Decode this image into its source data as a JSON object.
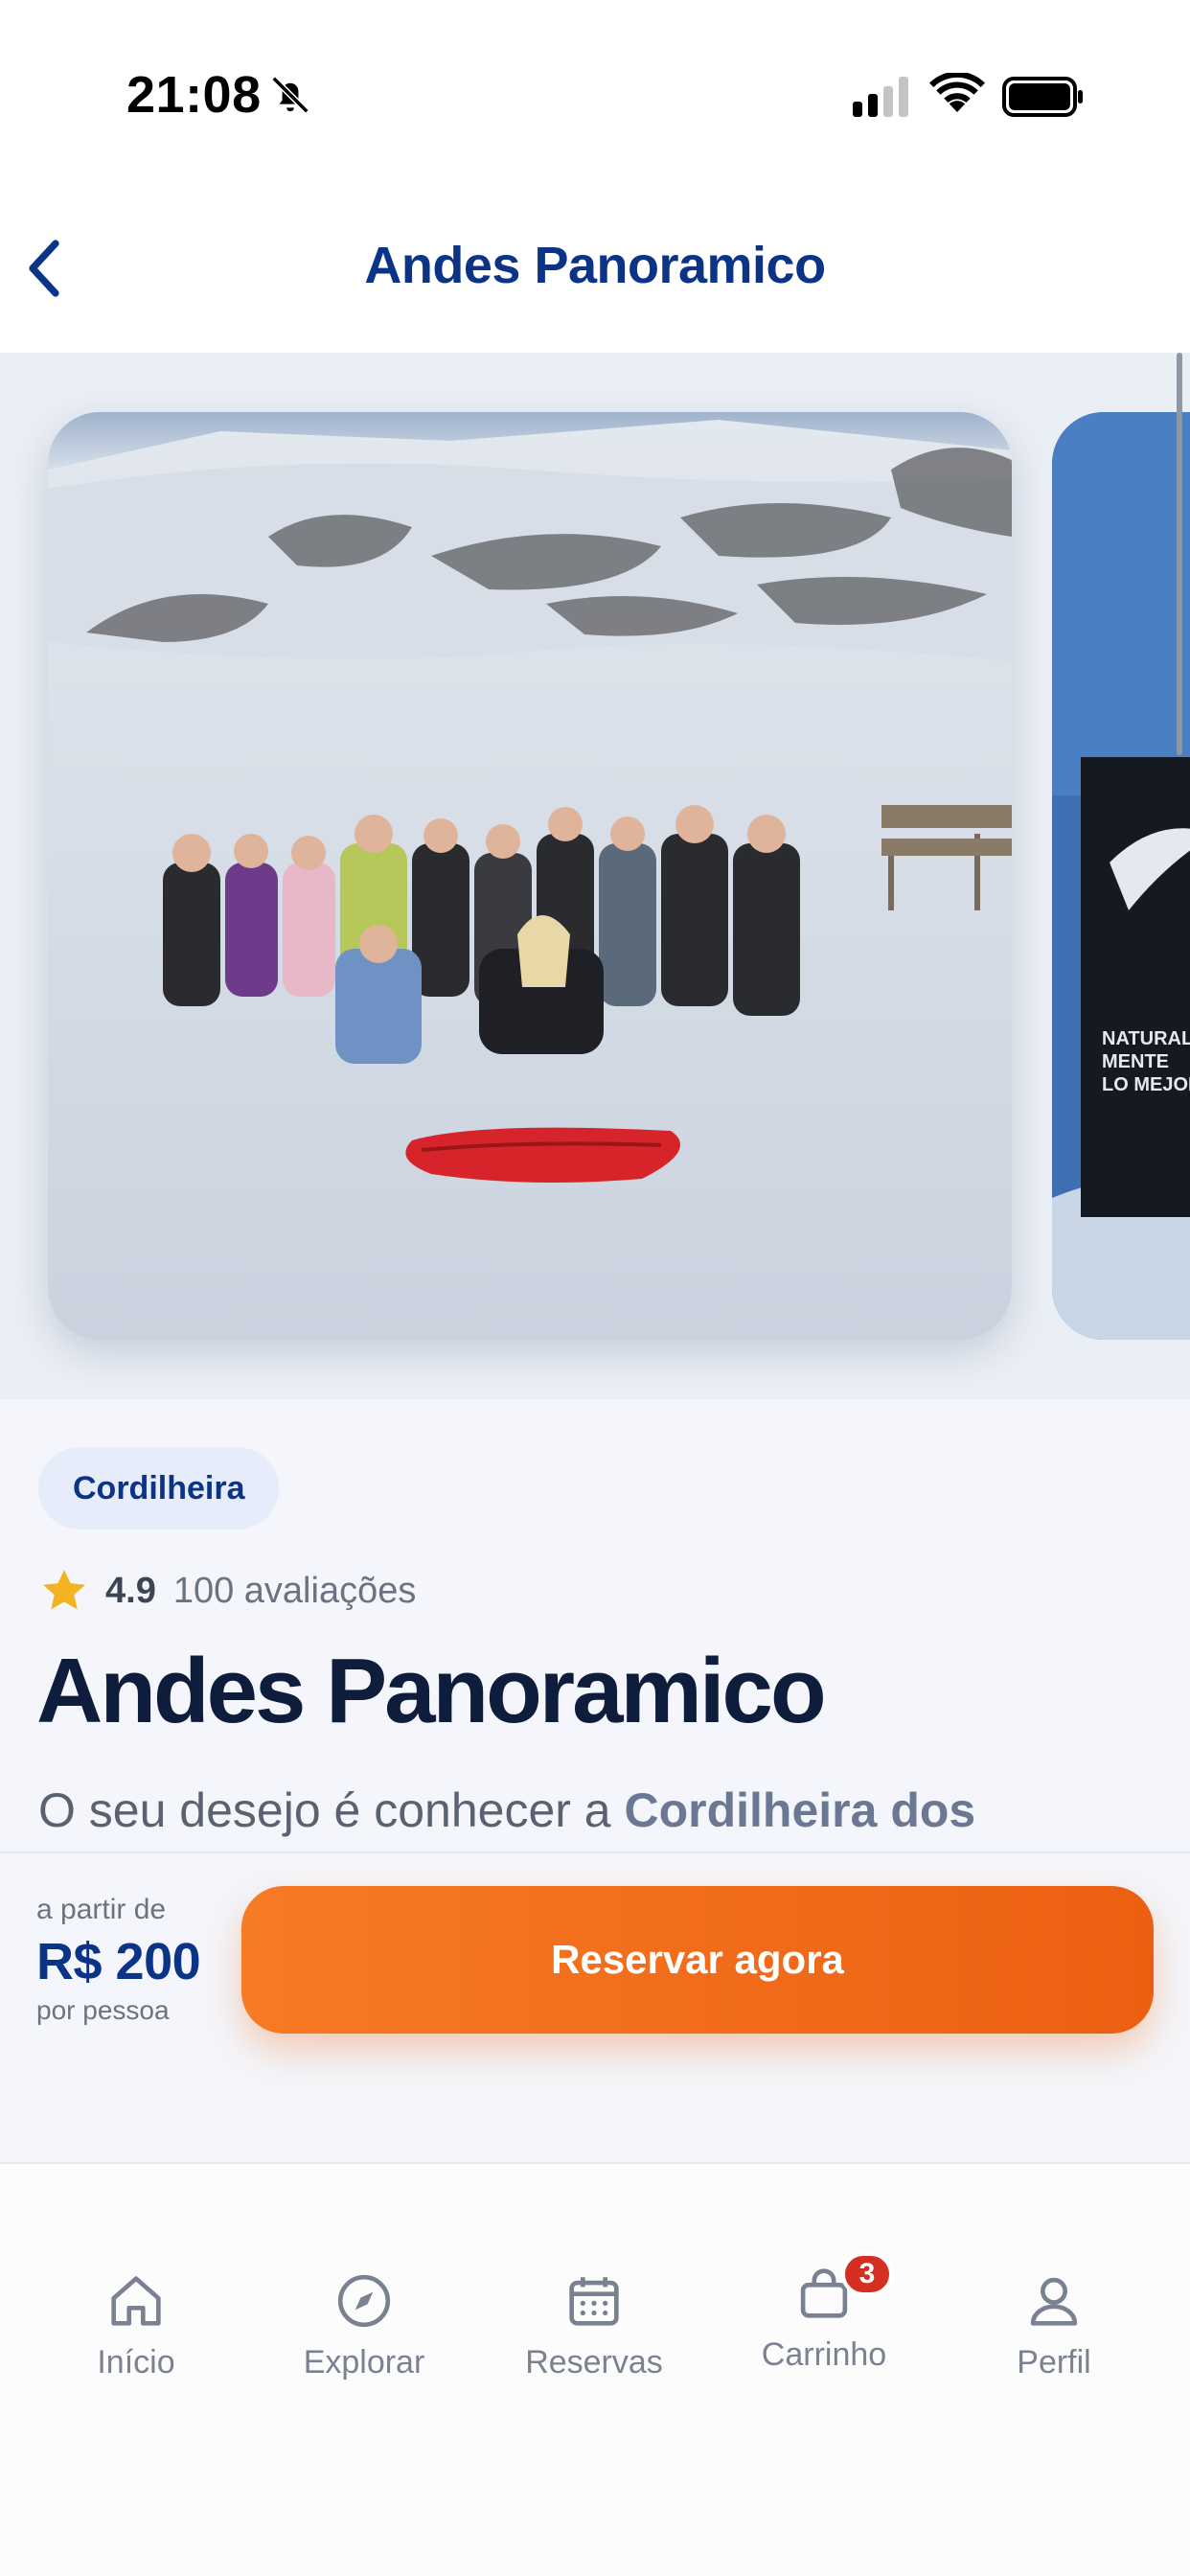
{
  "status_bar": {
    "time": "21:08"
  },
  "header": {
    "title": "Andes Panoramico"
  },
  "tour": {
    "category": "Cordilheira",
    "rating": "4.9",
    "review_count": "100 avaliações",
    "title": "Andes Panoramico",
    "description_prefix": "O seu desejo é conhecer a ",
    "description_highlight": "Cordilheira dos"
  },
  "booking": {
    "price_from": "a partir de",
    "price": "R$ 200",
    "price_unit": "por pessoa",
    "reserve_label": "Reservar agora"
  },
  "tabs": [
    {
      "label": "Início",
      "icon": "home-icon"
    },
    {
      "label": "Explorar",
      "icon": "compass-icon"
    },
    {
      "label": "Reservas",
      "icon": "calendar-icon"
    },
    {
      "label": "Carrinho",
      "icon": "bag-icon",
      "badge": "3"
    },
    {
      "label": "Perfil",
      "icon": "user-icon"
    }
  ],
  "colors": {
    "brand_blue": "#0b3386",
    "accent_orange": "#f77a24",
    "badge_red": "#d42f20"
  }
}
